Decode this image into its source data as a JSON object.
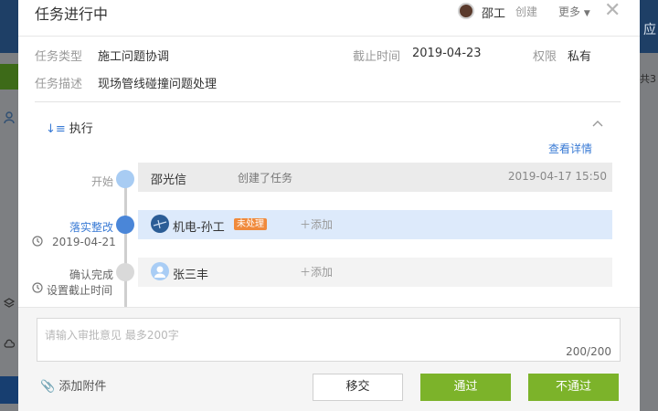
{
  "background": {
    "right_title": "应",
    "right_count": "共3",
    "colors": {
      "topbar": "#1e3f66",
      "green_button": "#3d6a18",
      "blue_button": "#173e70"
    }
  },
  "header": {
    "title": "任务进行中",
    "creator_name": "邵工",
    "creator_action": "创建",
    "more_label": "更多",
    "close_symbol": "✕"
  },
  "info": {
    "type_label": "任务类型",
    "type_value": "施工问题协调",
    "deadline_label": "截止时间",
    "deadline_value": "2019-04-23",
    "permission_label": "权限",
    "permission_value": "私有",
    "desc_label": "任务描述",
    "desc_value": "现场管线碰撞问题处理"
  },
  "execution": {
    "heading": "执行",
    "detail_link": "查看详情",
    "steps": [
      {
        "label": "开始",
        "person": "邵光信",
        "action": "创建了任务",
        "time": "2019-04-17 15:50"
      },
      {
        "label": "落实整改",
        "date": "2019-04-21",
        "person": "机电-孙工",
        "badge": "未处理",
        "add": "添加"
      },
      {
        "label": "确认完成",
        "deadline_hint": "设置截止时间",
        "person": "张三丰",
        "add": "添加"
      }
    ]
  },
  "footer": {
    "comment_placeholder": "请输入审批意见 最多200字",
    "counter": "200/200",
    "attach_label": "添加附件",
    "transfer_label": "移交",
    "pass_label": "通过",
    "reject_label": "不通过"
  },
  "colors": {
    "accent_blue": "#3a7bd5",
    "approve_green": "#7cb32a",
    "badge_orange": "#f08a3c",
    "active_row": "#ddeafb"
  }
}
